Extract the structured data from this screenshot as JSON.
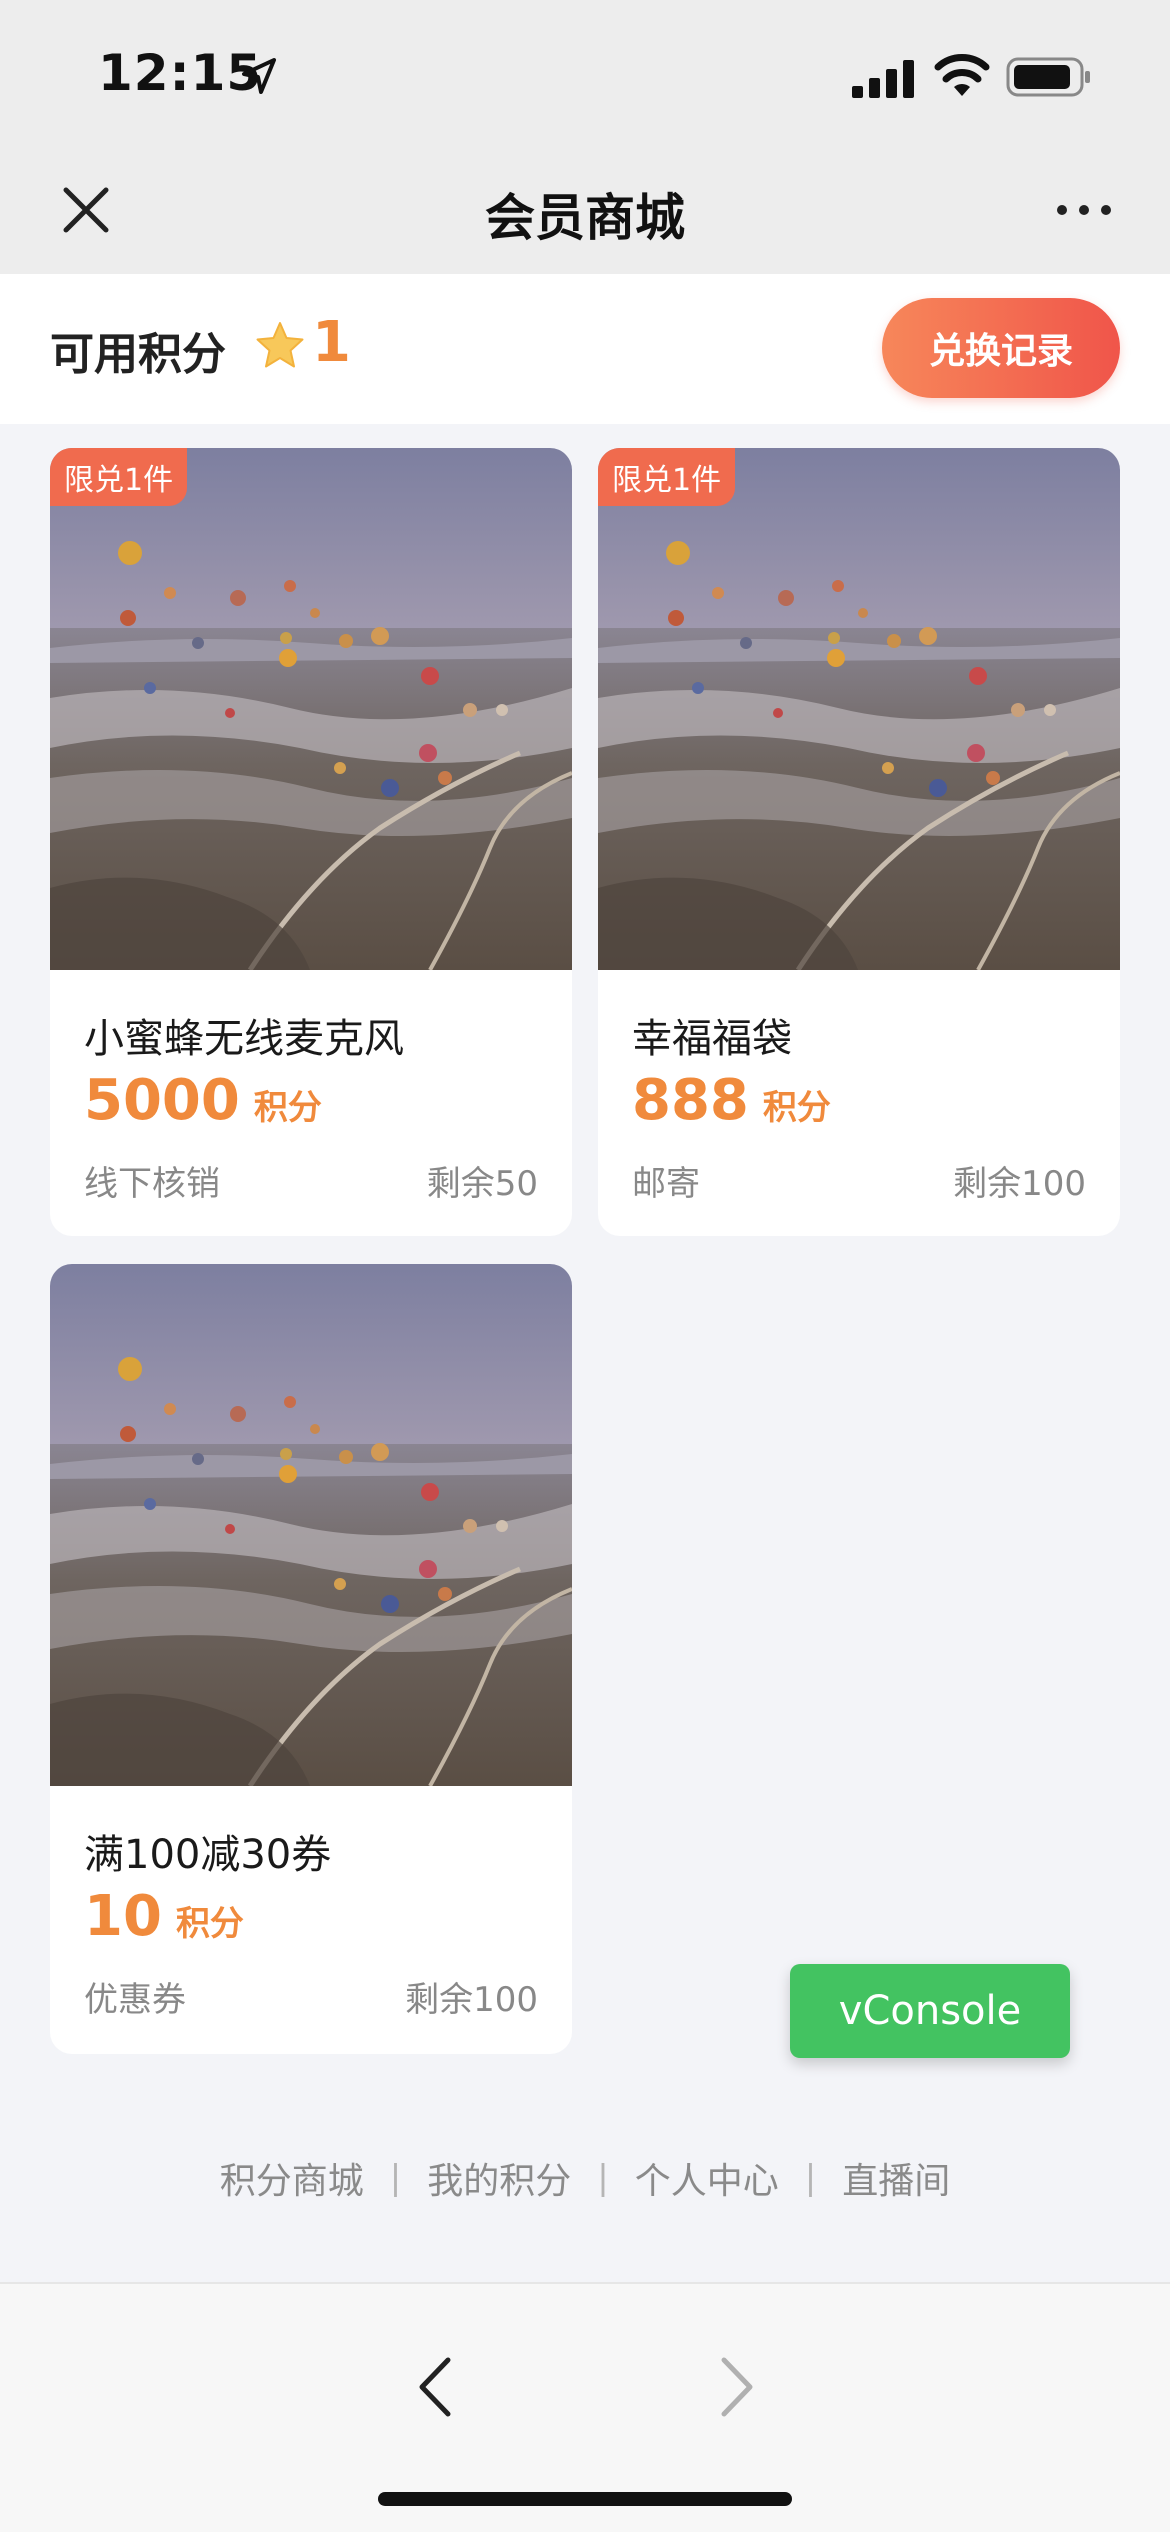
{
  "status_bar": {
    "time": "12:15"
  },
  "nav": {
    "title": "会员商城"
  },
  "points": {
    "label": "可用积分",
    "value": "1",
    "history_button": "兑换记录"
  },
  "products": [
    {
      "badge": "限兑1件",
      "title": "小蜜蜂无线麦克风",
      "price": "5000",
      "unit": "积分",
      "method": "线下核销",
      "stock": "剩余50"
    },
    {
      "badge": "限兑1件",
      "title": "幸福福袋",
      "price": "888",
      "unit": "积分",
      "method": "邮寄",
      "stock": "剩余100"
    },
    {
      "badge": "",
      "title": "满100减30券",
      "price": "10",
      "unit": "积分",
      "method": "优惠券",
      "stock": "剩余100"
    }
  ],
  "vconsole": {
    "label": "vConsole"
  },
  "footer": {
    "links": [
      "积分商城",
      "我的积分",
      "个人中心",
      "直播间"
    ]
  },
  "colors": {
    "accent": "#f08a3c",
    "badge": "#f06b4e",
    "vconsole": "#43c361"
  },
  "icons": [
    "location-arrow-icon",
    "signal-icon",
    "wifi-icon",
    "battery-icon",
    "close-icon",
    "more-icon",
    "star-icon",
    "back-arrow-icon",
    "forward-arrow-icon"
  ]
}
